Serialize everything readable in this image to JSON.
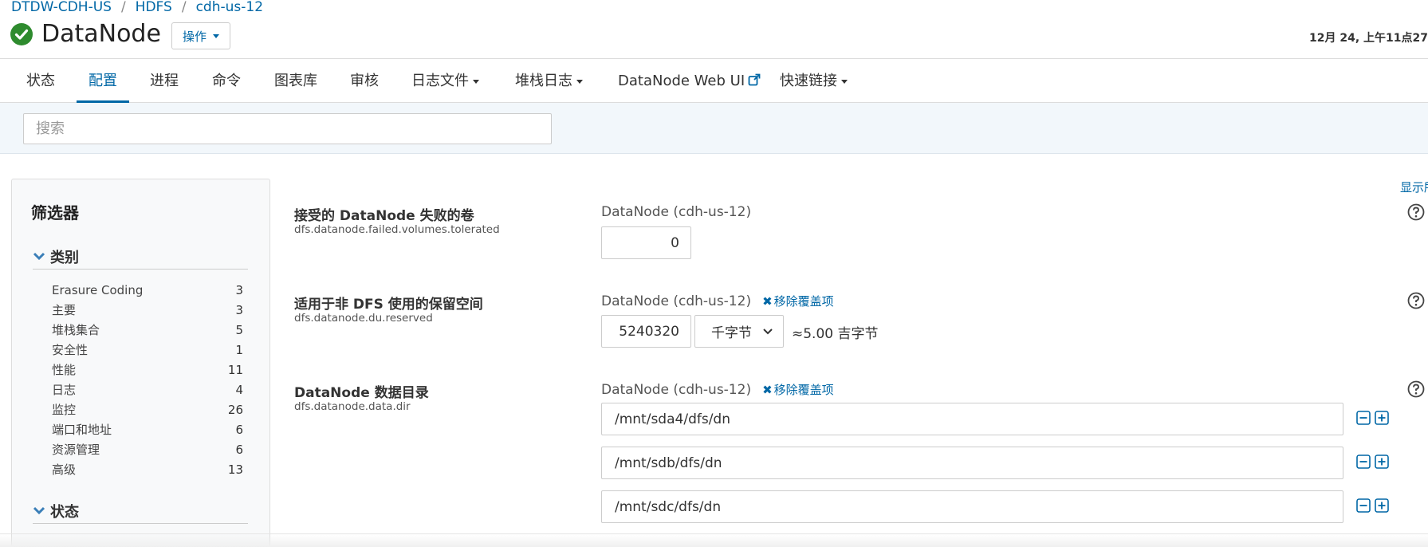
{
  "breadcrumb": {
    "cluster": "DTDW-CDH-US",
    "service": "HDFS",
    "host": "cdh-us-12",
    "separator": "/"
  },
  "header": {
    "title": "DataNode",
    "actions_label": "操作",
    "timestamp": "12月 24, 上午11点27"
  },
  "tabs": [
    {
      "label": "状态"
    },
    {
      "label": "配置"
    },
    {
      "label": "进程"
    },
    {
      "label": "命令"
    },
    {
      "label": "图表库"
    },
    {
      "label": "审核"
    },
    {
      "label": "日志文件"
    },
    {
      "label": "堆栈日志"
    },
    {
      "label": "DataNode Web UI"
    },
    {
      "label": "快速链接"
    }
  ],
  "active_tab": "配置",
  "search": {
    "placeholder": "搜索",
    "value": ""
  },
  "filters": {
    "title": "筛选器",
    "category_label": "类别",
    "categories": [
      {
        "label": "Erasure Coding",
        "count": "3"
      },
      {
        "label": "主要",
        "count": "3"
      },
      {
        "label": "堆栈集合",
        "count": "5"
      },
      {
        "label": "安全性",
        "count": "1"
      },
      {
        "label": "性能",
        "count": "11"
      },
      {
        "label": "日志",
        "count": "4"
      },
      {
        "label": "监控",
        "count": "26"
      },
      {
        "label": "端口和地址",
        "count": "6"
      },
      {
        "label": "资源管理",
        "count": "6"
      },
      {
        "label": "高级",
        "count": "13"
      }
    ],
    "status_label": "状态"
  },
  "show_link": "显示所",
  "settings": [
    {
      "title": "接受的 DataNode 失败的卷",
      "key": "dfs.datanode.failed.volumes.tolerated",
      "scope": "DataNode (cdh-us-12)",
      "value": "0"
    },
    {
      "title": "适用于非 DFS 使用的保留空间",
      "key": "dfs.datanode.du.reserved",
      "scope": "DataNode (cdh-us-12)",
      "remove_override": "移除覆盖项",
      "value": "5240320",
      "unit": "千字节",
      "approx": "≈5.00 吉字节"
    },
    {
      "title": "DataNode 数据目录",
      "key": "dfs.datanode.data.dir",
      "scope": "DataNode (cdh-us-12)",
      "remove_override": "移除覆盖项",
      "dirs": [
        "/mnt/sda4/dfs/dn",
        "/mnt/sdb/dfs/dn",
        "/mnt/sdc/dfs/dn"
      ]
    }
  ],
  "colors": {
    "accent": "#0067a6",
    "success": "#2e8b2e",
    "search_band": "#f2f7fb"
  }
}
